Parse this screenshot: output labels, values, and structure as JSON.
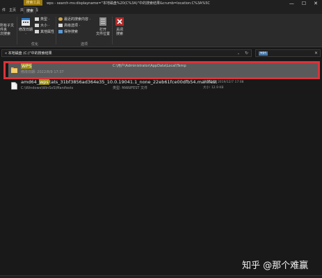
{
  "titlebar": {
    "context_tab": "搜索工具",
    "title": "wps - search-ms:displayname=\"本地磁盘%20(C%3A)\"中的搜索结果&crumb=location:C%3A%5C",
    "controls": [
      "—",
      "☐",
      "✕"
    ]
  },
  "ribbon_tabs": [
    "件",
    "主页",
    "共享",
    "查看",
    "搜索"
  ],
  "ribbon": {
    "location": {
      "big_label": "所有子文件夹",
      "sub_label": "次搜索"
    },
    "refine": {
      "date_label": "修改日期",
      "date_sub": "·",
      "items": [
        "类型 ·",
        "大小 ·",
        "其他属性 ·"
      ],
      "group_label": "优化"
    },
    "options": {
      "items": [
        "最近的搜索内容 ·",
        "高级选项 ·",
        "保存搜索"
      ],
      "open_label": "打开",
      "open_sub": "文件位置",
      "group_label": "选项"
    },
    "close": {
      "label": "关闭",
      "sub": "搜索"
    }
  },
  "address": {
    "text": "« 本地磁盘 (C:)\"中的搜索结果",
    "chevron": "⌄",
    "refresh": "↻"
  },
  "search": {
    "query": "wps",
    "clear": "✕"
  },
  "results": [
    {
      "type": "folder",
      "name_highlight": "WPS",
      "name_rest": "",
      "sub": "修改日期: 2022/8/9 17:37",
      "path": "C:\\用户\\Administrator\\AppData\\Local\\Temp",
      "selected": true
    },
    {
      "type": "file",
      "name_pre": "amd64_",
      "name_highlight": "wps",
      "name_rest": "tats_31bf3856ad364e35_10.0.19041.1_none_22eb61fce00dfb54.manifest",
      "sub": "C:\\Windows\\WinSxS\\Manifests",
      "type_text": "类型: MANIFEST 文件",
      "meta_date": "修改日期: 2019/12/7 17:08",
      "meta_size": "大小: 12.9 KB",
      "selected": false
    }
  ],
  "watermark": "知乎 @那个难赢",
  "colors": {
    "selection_outline": "#d9343a",
    "highlight": "#9a8e14",
    "folder": "#e6b84a"
  }
}
